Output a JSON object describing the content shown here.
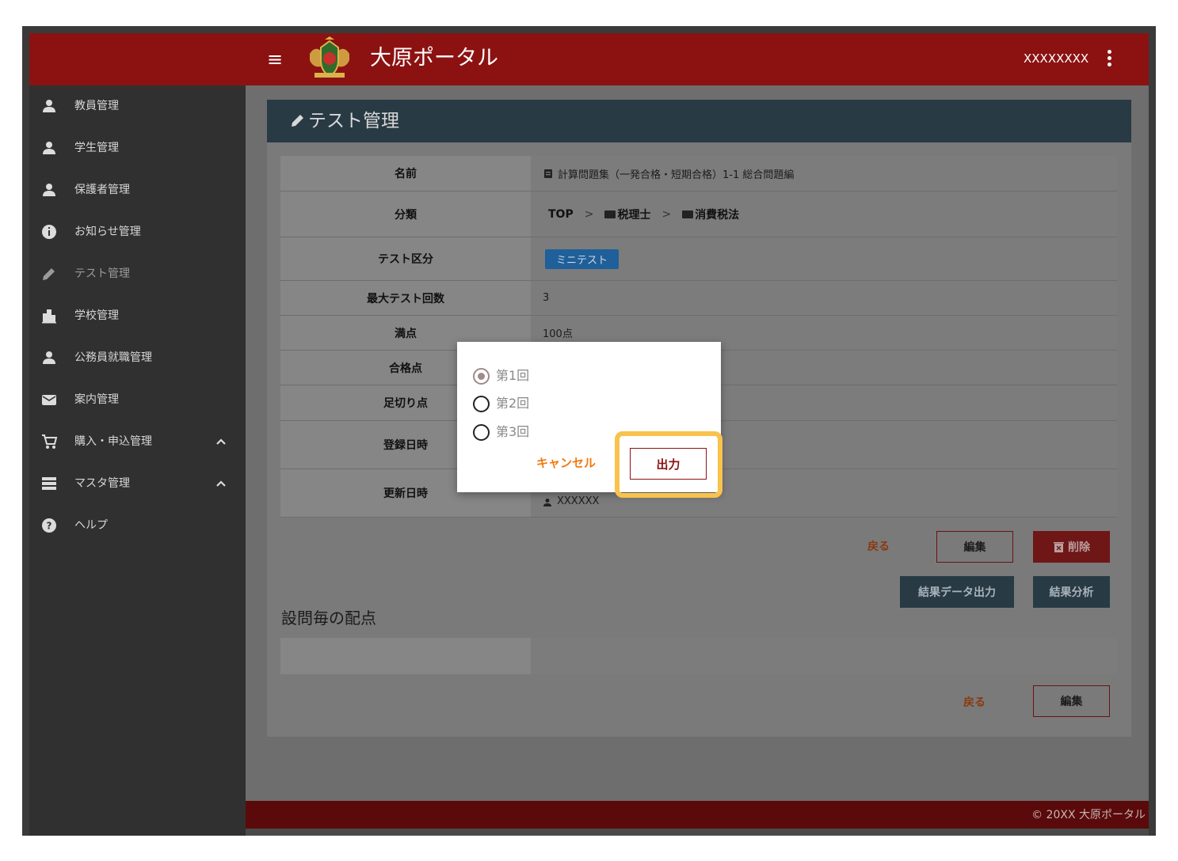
{
  "header": {
    "app_title": "大原ポータル",
    "user_name": "XXXXXXXX",
    "hamburger_glyph": "≡"
  },
  "sidebar": {
    "items": [
      {
        "label": "教員管理",
        "icon": "person-icon"
      },
      {
        "label": "学生管理",
        "icon": "person-icon"
      },
      {
        "label": "保護者管理",
        "icon": "person-icon"
      },
      {
        "label": "お知らせ管理",
        "icon": "info-icon"
      },
      {
        "label": "テスト管理",
        "icon": "pencil-icon",
        "active": true
      },
      {
        "label": "学校管理",
        "icon": "building-icon"
      },
      {
        "label": "公務員就職管理",
        "icon": "person-icon"
      },
      {
        "label": "案内管理",
        "icon": "mail-icon"
      },
      {
        "label": "購入・申込管理",
        "icon": "cart-icon",
        "expandable": true
      },
      {
        "label": "マスタ管理",
        "icon": "storage-icon",
        "expandable": true
      },
      {
        "label": "ヘルプ",
        "icon": "help-icon"
      }
    ]
  },
  "page": {
    "title": "テスト管理"
  },
  "detail": {
    "rows": [
      {
        "label": "名前",
        "value": "計算問題集（一発合格・短期合格）1-1 総合問題編"
      },
      {
        "label": "分類",
        "crumbs": [
          "TOP",
          "税理士",
          "消費税法"
        ],
        "separator": ">"
      },
      {
        "label": "テスト区分",
        "badge": "ミニテスト"
      },
      {
        "label": "最大テスト回数",
        "value": "3"
      },
      {
        "label": "満点",
        "value": "100点"
      },
      {
        "label": "合格点",
        "value": ""
      },
      {
        "label": "足切り点",
        "value": ""
      },
      {
        "label": "登録日時",
        "value": ""
      },
      {
        "label": "更新日時",
        "value": "XXXXXX"
      }
    ]
  },
  "actions": {
    "back": "戻る",
    "edit": "編集",
    "delete": "削除",
    "export_results": "結果データ出力",
    "analyze": "結果分析"
  },
  "scores_section": {
    "title": "設問毎の配点"
  },
  "footer": {
    "text": "© 20XX 大原ポータル"
  },
  "dialog": {
    "options": [
      {
        "label": "第1回",
        "checked": true
      },
      {
        "label": "第2回",
        "checked": false
      },
      {
        "label": "第3回",
        "checked": false
      }
    ],
    "cancel": "キャンセル",
    "output": "出力"
  },
  "colors": {
    "brand_red": "#8c1212",
    "highlight": "#f9c24d",
    "cancel_orange": "#f07a10"
  }
}
